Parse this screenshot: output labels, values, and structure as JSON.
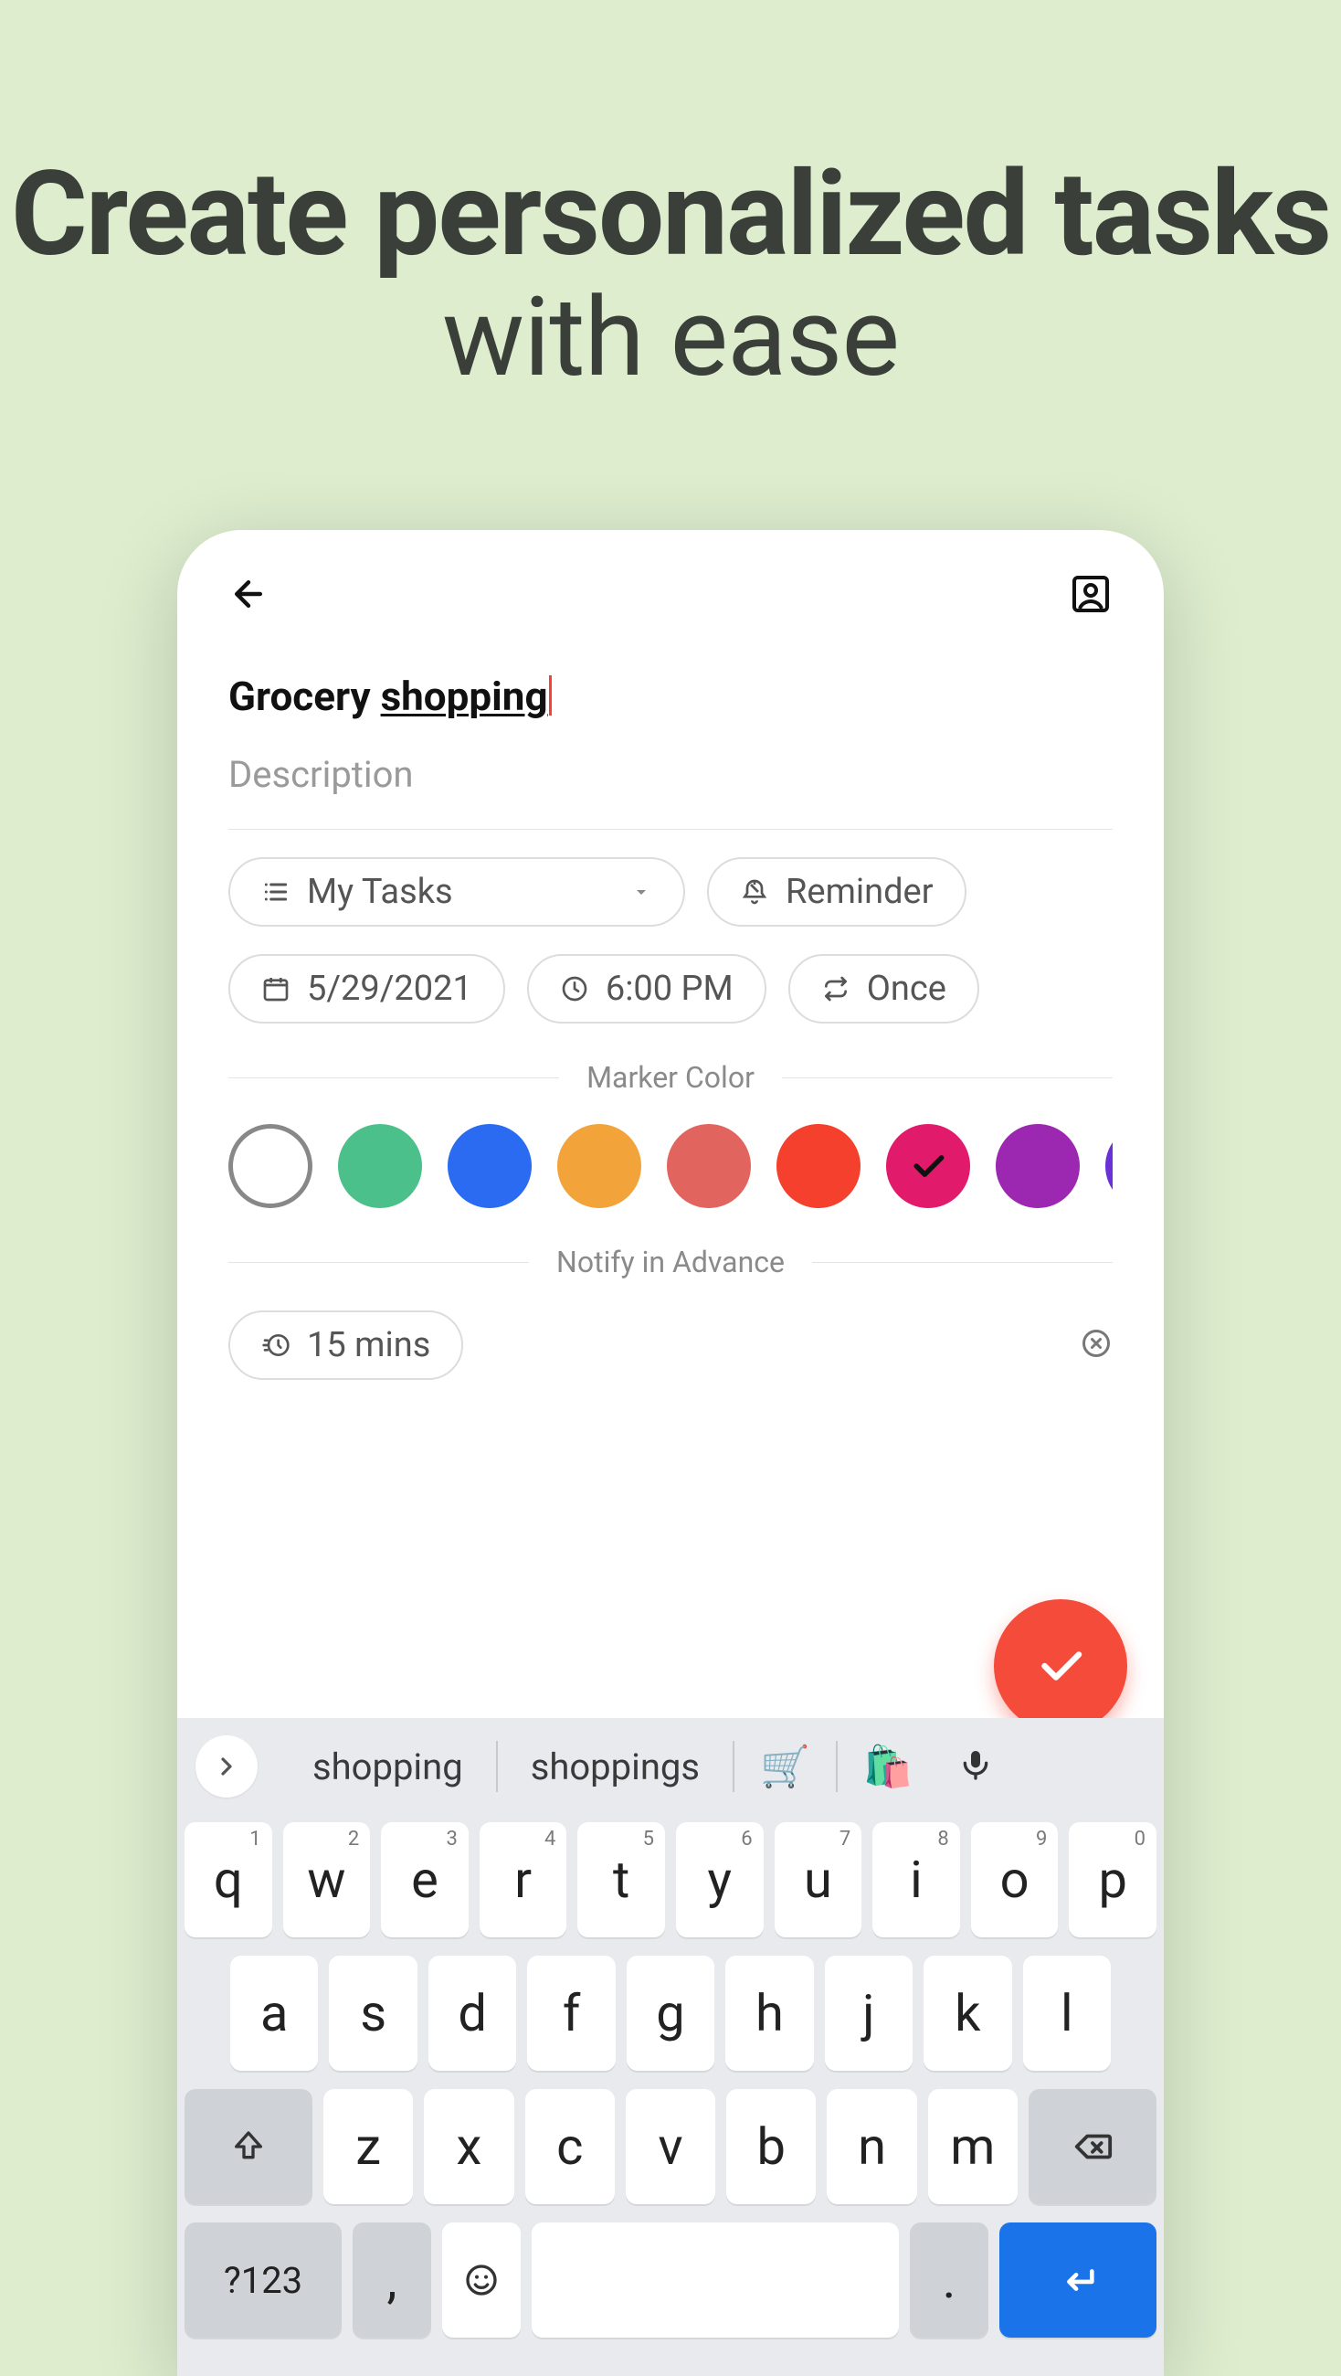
{
  "headline": {
    "line1": "Create personalized tasks",
    "line2": "with ease"
  },
  "header": {
    "back": "back",
    "profile": "profile"
  },
  "task": {
    "title_prefix": "Grocery ",
    "title_underlined": "shopping",
    "description_placeholder": "Description",
    "list_label": "My Tasks",
    "reminder_label": "Reminder",
    "date_label": "5/29/2021",
    "time_label": "6:00 PM",
    "repeat_label": "Once",
    "marker_section": "Marker Color",
    "notify_section": "Notify in Advance",
    "notify_value": "15 mins"
  },
  "colors": [
    {
      "hex": "#ffffff",
      "outline": true,
      "selected": false
    },
    {
      "hex": "#4bc08a",
      "outline": false,
      "selected": false
    },
    {
      "hex": "#2a6bf2",
      "outline": false,
      "selected": false
    },
    {
      "hex": "#f2a43a",
      "outline": false,
      "selected": false
    },
    {
      "hex": "#e2645e",
      "outline": false,
      "selected": false
    },
    {
      "hex": "#f4402c",
      "outline": false,
      "selected": false
    },
    {
      "hex": "#e21a6b",
      "outline": false,
      "selected": true
    },
    {
      "hex": "#9c27b0",
      "outline": false,
      "selected": false
    },
    {
      "hex": "#6a32d6",
      "outline": false,
      "selected": false
    }
  ],
  "keyboard": {
    "suggestions": [
      "shopping",
      "shoppings"
    ],
    "emoji_suggestions": [
      "🛒",
      "🛍️"
    ],
    "row1": [
      {
        "k": "q",
        "n": "1"
      },
      {
        "k": "w",
        "n": "2"
      },
      {
        "k": "e",
        "n": "3"
      },
      {
        "k": "r",
        "n": "4"
      },
      {
        "k": "t",
        "n": "5"
      },
      {
        "k": "y",
        "n": "6"
      },
      {
        "k": "u",
        "n": "7"
      },
      {
        "k": "i",
        "n": "8"
      },
      {
        "k": "o",
        "n": "9"
      },
      {
        "k": "p",
        "n": "0"
      }
    ],
    "row2": [
      "a",
      "s",
      "d",
      "f",
      "g",
      "h",
      "j",
      "k",
      "l"
    ],
    "row3": [
      "z",
      "x",
      "c",
      "v",
      "b",
      "n",
      "m"
    ],
    "sym": "?123",
    "comma": ",",
    "period": "."
  }
}
